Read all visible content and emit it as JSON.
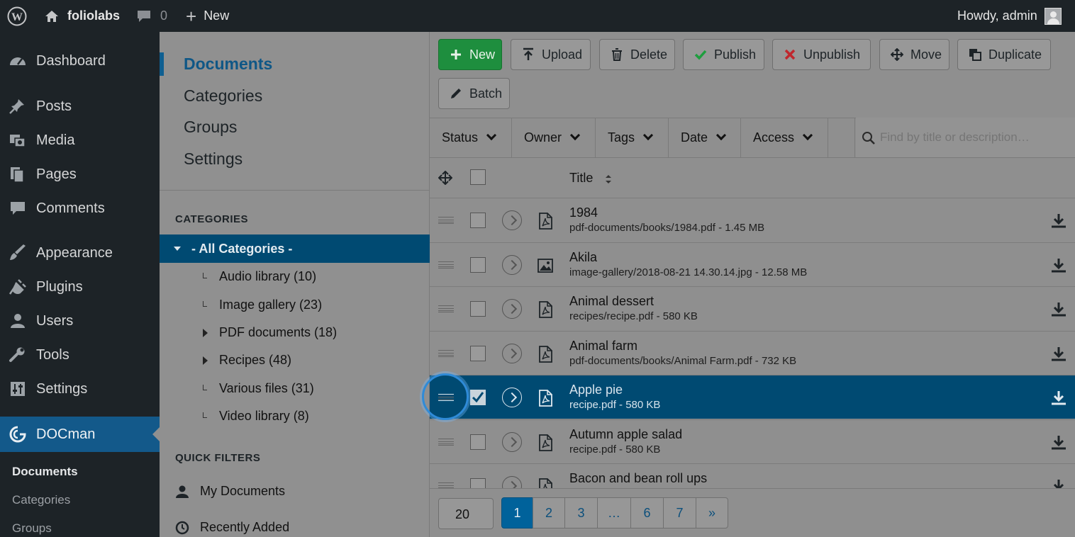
{
  "adminbar": {
    "site": "foliolabs",
    "comments": "0",
    "new": "New",
    "howdy": "Howdy, admin"
  },
  "menu": {
    "dashboard": "Dashboard",
    "posts": "Posts",
    "media": "Media",
    "pages": "Pages",
    "comments": "Comments",
    "appearance": "Appearance",
    "plugins": "Plugins",
    "users": "Users",
    "tools": "Tools",
    "settings": "Settings",
    "docman": "DOCman",
    "sub": [
      "Documents",
      "Categories",
      "Groups"
    ]
  },
  "docnav": {
    "documents": "Documents",
    "categories": "Categories",
    "groups": "Groups",
    "settings": "Settings"
  },
  "categories": {
    "heading": "CATEGORIES",
    "all": "- All Categories -",
    "items": [
      "Audio library (10)",
      "Image gallery (23)",
      "PDF documents (18)",
      "Recipes (48)",
      "Various files (31)",
      "Video library (8)"
    ]
  },
  "quickfilters": {
    "heading": "QUICK FILTERS",
    "my": "My Documents",
    "recent": "Recently Added"
  },
  "toolbar": {
    "new": "New",
    "upload": "Upload",
    "delete": "Delete",
    "publish": "Publish",
    "unpublish": "Unpublish",
    "move": "Move",
    "duplicate": "Duplicate",
    "batch": "Batch"
  },
  "filters": {
    "status": "Status",
    "owner": "Owner",
    "tags": "Tags",
    "date": "Date",
    "access": "Access",
    "search_placeholder": "Find by title or description…"
  },
  "table": {
    "title_header": "Title",
    "rows": [
      {
        "title": "1984",
        "path": "pdf-documents/books/1984.pdf - 1.45 MB",
        "type": "pdf"
      },
      {
        "title": "Akila",
        "path": "image-gallery/2018-08-21 14.30.14.jpg - 12.58 MB",
        "type": "image"
      },
      {
        "title": "Animal dessert",
        "path": "recipes/recipe.pdf - 580 KB",
        "type": "pdf"
      },
      {
        "title": "Animal farm",
        "path": "pdf-documents/books/Animal Farm.pdf - 732 KB",
        "type": "pdf"
      },
      {
        "title": "Apple pie",
        "path": "recipe.pdf - 580 KB",
        "type": "pdf",
        "selected": true
      },
      {
        "title": "Autumn apple salad",
        "path": "recipe.pdf - 580 KB",
        "type": "pdf"
      },
      {
        "title": "Bacon and bean roll ups",
        "path": "",
        "type": "pdf"
      }
    ]
  },
  "pagination": {
    "limit": "20",
    "pages": [
      "1",
      "2",
      "3",
      "…",
      "6",
      "7",
      "»"
    ],
    "current": "1"
  },
  "colors": {
    "accent": "#00629b",
    "selected_row": "#004a72",
    "new_button": "#1e8e3e",
    "publish_check": "#1e9e3e",
    "unpublish_x": "#c0272d"
  }
}
